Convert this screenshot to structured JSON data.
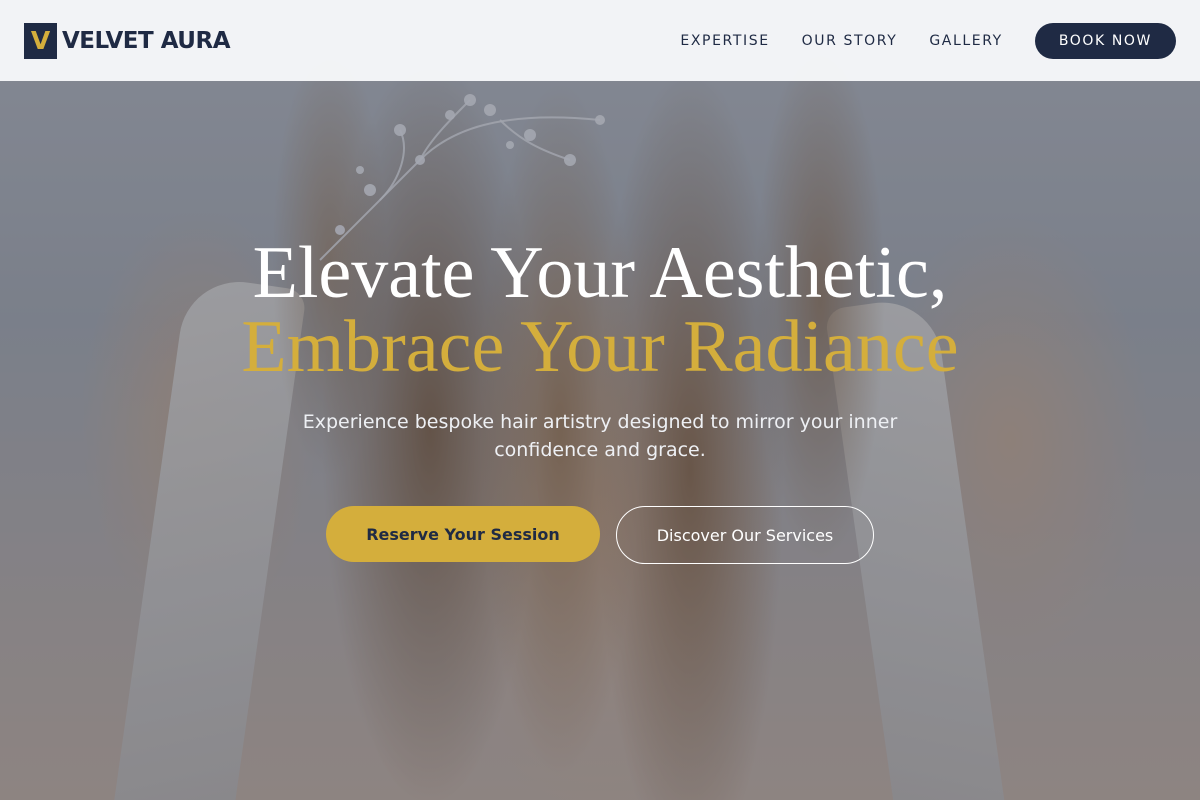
{
  "brand": {
    "mark": "V",
    "name": "VELVET AURA"
  },
  "nav": {
    "links": [
      "EXPERTISE",
      "OUR STORY",
      "GALLERY"
    ],
    "book_label": "BOOK NOW"
  },
  "hero": {
    "headline_line_1": "Elevate Your Aesthetic,",
    "headline_line_2": "Embrace Your Radiance",
    "subtitle": "Experience bespoke hair artistry designed to mirror your inner confidence and grace.",
    "primary_cta": "Reserve Your Session",
    "secondary_cta": "Discover Our Services",
    "background_image": "woman-with-wavy-hair-and-hair-vine"
  },
  "colors": {
    "navy": "#1f2a44",
    "gold": "#d4ae3c",
    "header_bg": "#f6f7f9",
    "white": "#ffffff"
  }
}
